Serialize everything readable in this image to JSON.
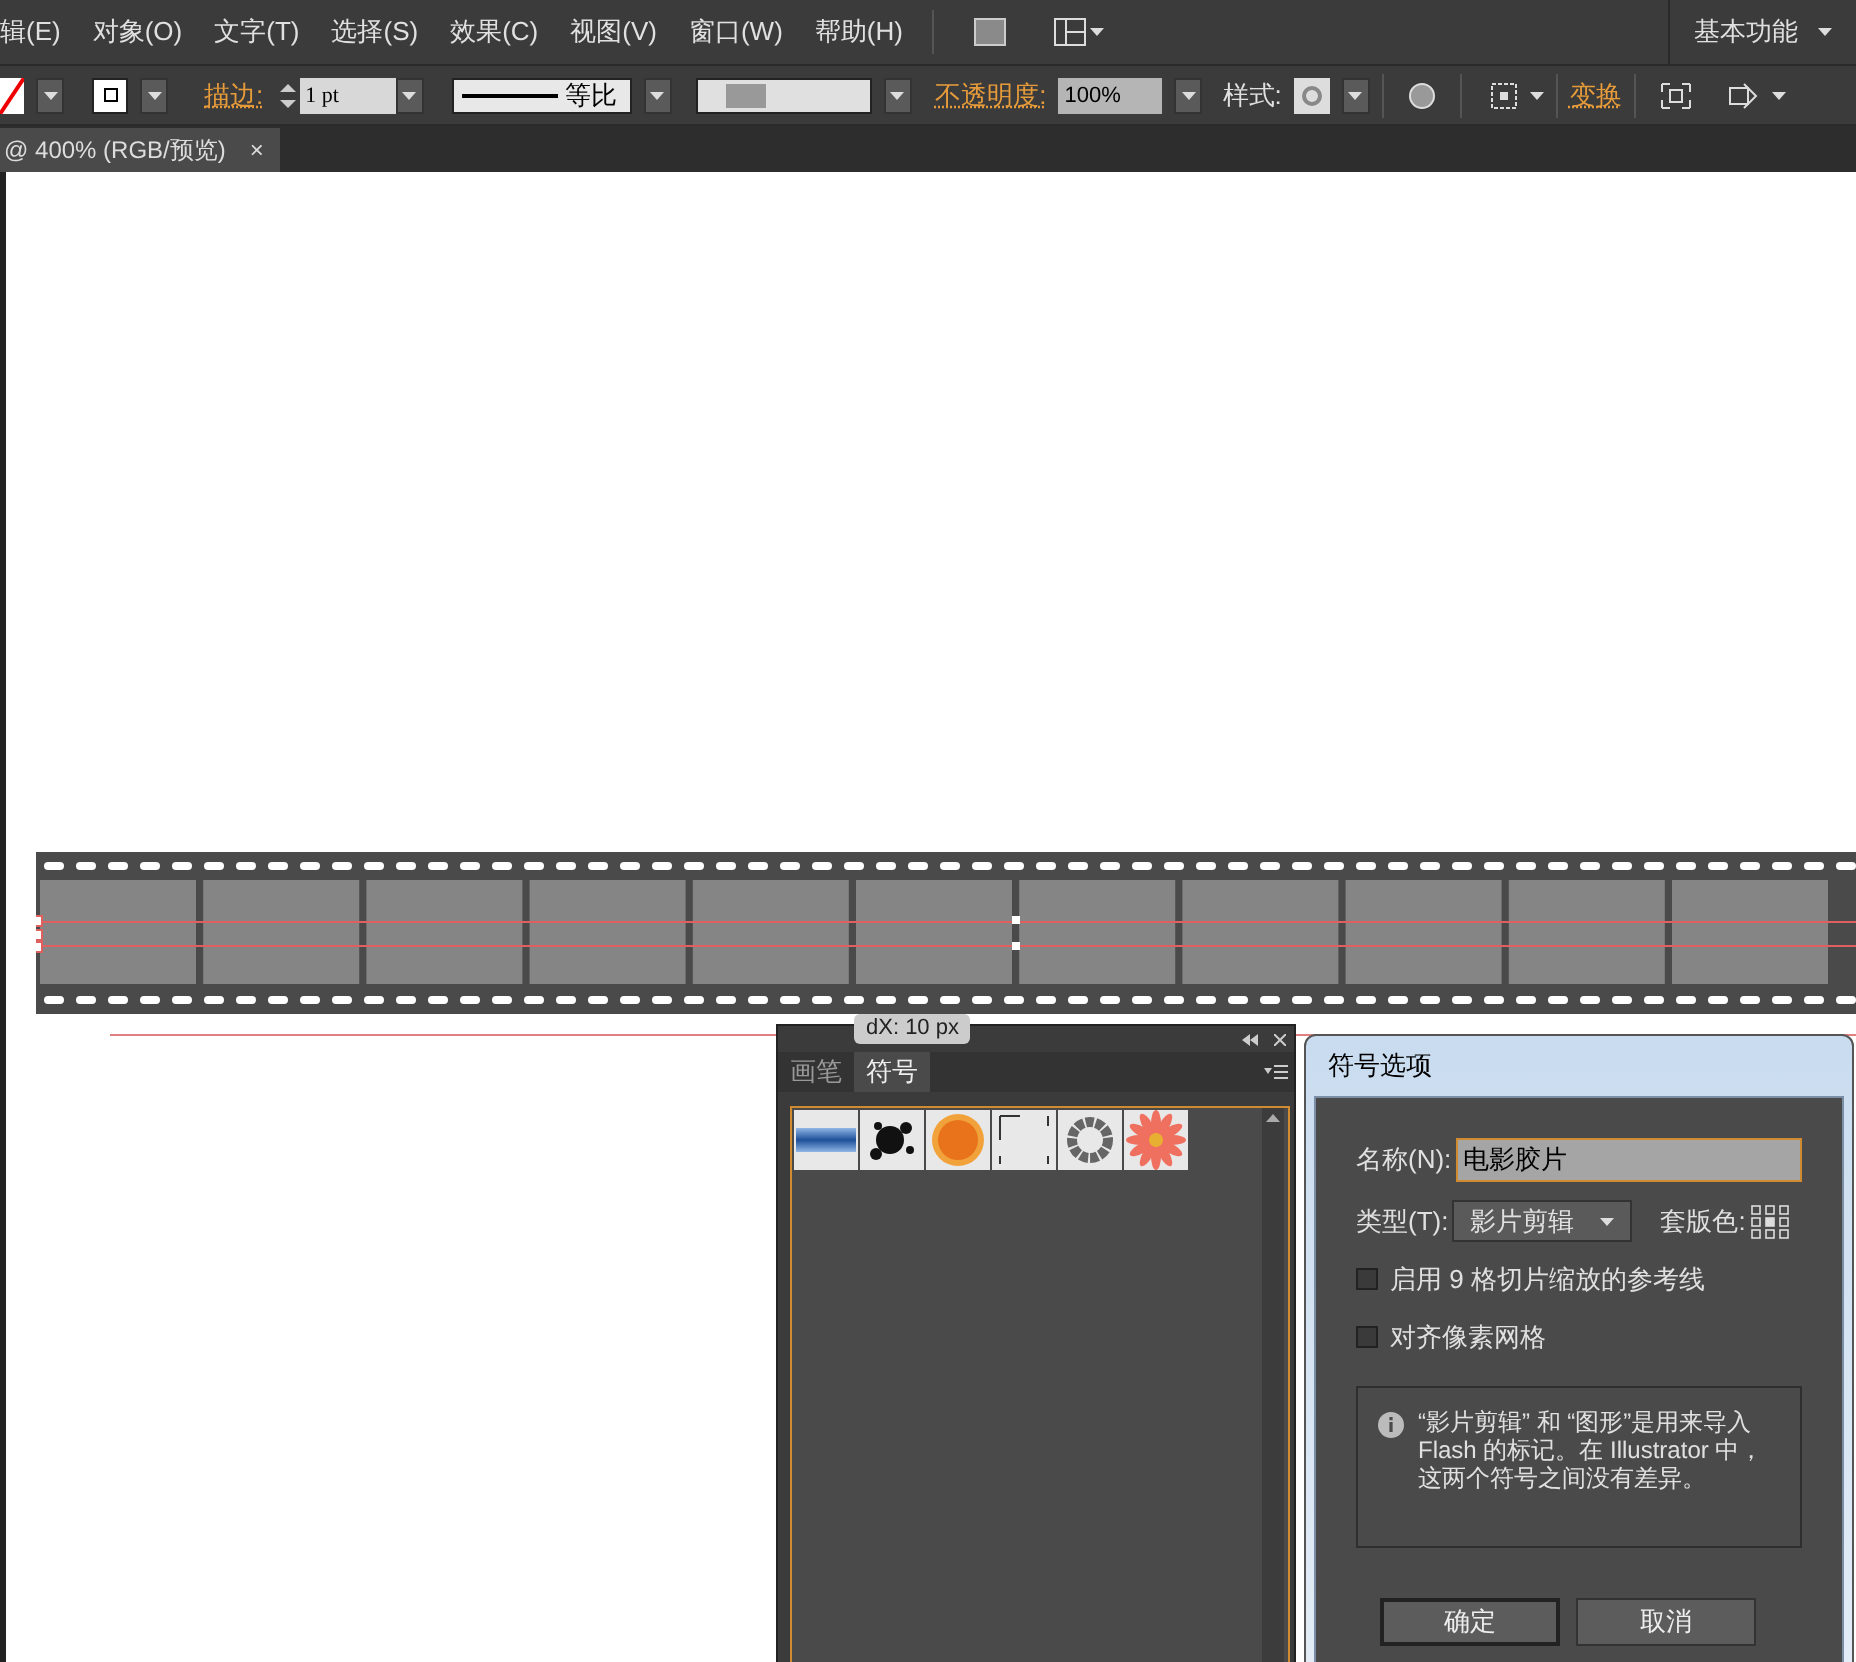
{
  "menu_bar": {
    "items": [
      "辑(E)",
      "对象(O)",
      "文字(T)",
      "选择(S)",
      "效果(C)",
      "视图(V)",
      "窗口(W)",
      "帮助(H)"
    ],
    "workspace": "基本功能"
  },
  "control_bar": {
    "stroke_label": "描边:",
    "stroke_weight": "1 pt",
    "stroke_profile": "等比",
    "opacity_label": "不透明度:",
    "opacity": "100%",
    "style_label": "样式:",
    "transform": "变换"
  },
  "document_tab": {
    "title": "@ 400% (RGB/预览)",
    "close": "×"
  },
  "tooltip": "dX: 10 px",
  "symbols_panel": {
    "tabs": [
      {
        "label": "画笔",
        "selected": false
      },
      {
        "label": "符号",
        "selected": true
      }
    ]
  },
  "dialog": {
    "title": "符号选项",
    "name_label": "名称(N):",
    "name_value": "电影胶片",
    "type_label": "类型(T):",
    "type_value": "影片剪辑",
    "registration_label": "套版色:",
    "checkboxes": [
      {
        "label": "启用 9 格切片缩放的参考线",
        "checked": false
      },
      {
        "label": "对齐像素网格",
        "checked": false
      }
    ],
    "info": "“影片剪辑” 和 “图形”是用来导入 Flash 的标记。在 Illustrator 中，这两个符号之间没有差异。",
    "buttons": [
      "确定",
      "取消"
    ]
  }
}
